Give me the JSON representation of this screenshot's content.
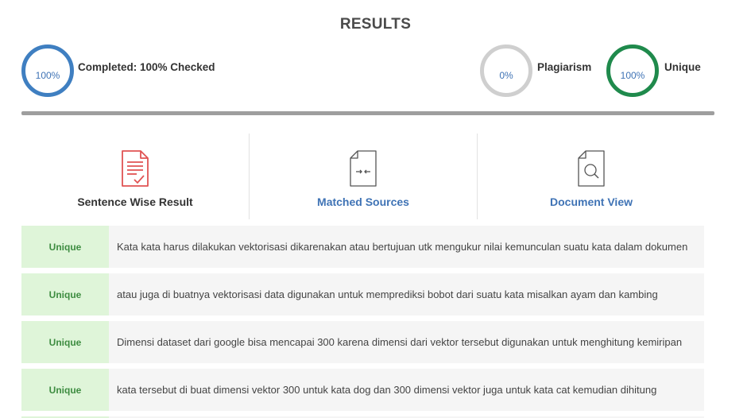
{
  "header": {
    "title": "RESULTS"
  },
  "stats": {
    "completed": {
      "percent_text": "100%",
      "label": "Completed: 100% Checked",
      "ring_color": "#3f7fc1"
    },
    "plagiarism": {
      "percent_text": "0%",
      "label": "Plagiarism",
      "ring_color": "#cfcfcf"
    },
    "unique": {
      "percent_text": "100%",
      "label": "Unique",
      "ring_color": "#1f8a4c"
    }
  },
  "colors": {
    "link_blue": "#3f73b5",
    "accent_red": "#e05353",
    "unique_green_bg": "#dff5d9",
    "unique_green_text": "#3d8c40"
  },
  "tabs": [
    {
      "label": "Sentence Wise Result",
      "icon": "sentence-document-icon",
      "active": true
    },
    {
      "label": "Matched Sources",
      "icon": "compare-document-icon",
      "active": false
    },
    {
      "label": "Document View",
      "icon": "search-document-icon",
      "active": false
    }
  ],
  "results": [
    {
      "status": "Unique",
      "text": "Kata kata harus dilakukan vektorisasi dikarenakan atau bertujuan utk mengukur nilai kemunculan suatu kata dalam dokumen"
    },
    {
      "status": "Unique",
      "text": "atau juga di buatnya vektorisasi data digunakan untuk memprediksi bobot dari suatu kata misalkan ayam dan kambing"
    },
    {
      "status": "Unique",
      "text": "Dimensi dataset dari google bisa mencapai 300 karena dimensi dari vektor tersebut digunakan untuk menghitung kemiripan"
    },
    {
      "status": "Unique",
      "text": "kata tersebut di buat dimensi vektor 300 untuk kata dog dan 300 dimensi vektor juga untuk kata cat kemudian dihitung"
    }
  ]
}
